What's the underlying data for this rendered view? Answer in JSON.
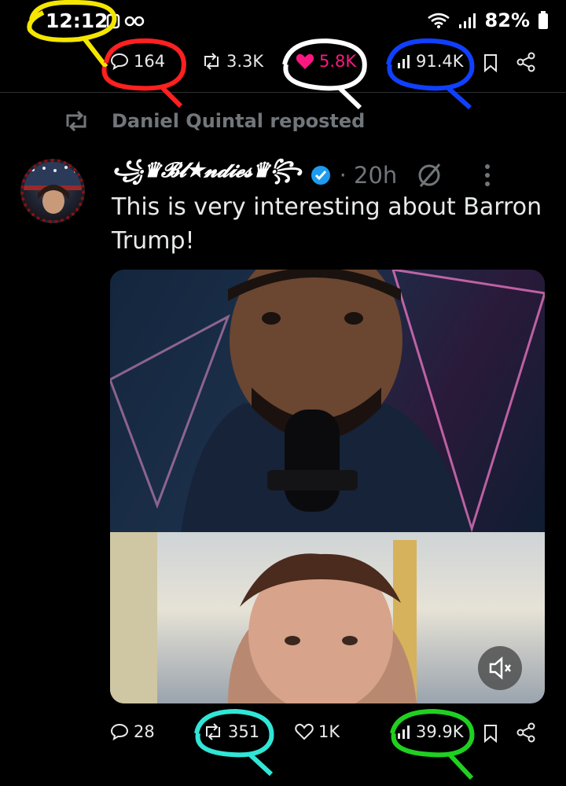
{
  "status_bar": {
    "time": "12:12",
    "battery": "82%"
  },
  "tweet1_actions": {
    "replies": "164",
    "reposts": "3.3K",
    "likes": "5.8K",
    "views": "91.4K"
  },
  "repost": {
    "text": "Daniel Quintal reposted"
  },
  "tweet2": {
    "display_name": "꧁♛𝓑𝓵★𝓷𝓭𝓲𝓮𝓼♛꧂",
    "age": "· 20h",
    "text": "This is very interesting about Barron Trump!",
    "actions": {
      "replies": "28",
      "reposts": "351",
      "likes": "1K",
      "views": "39.9K"
    }
  },
  "colors": {
    "background": "#000000",
    "like_pink": "#f91880",
    "verified_blue": "#1d9bf0",
    "muted_text": "#71767b",
    "annot_yellow": "#f5e600",
    "annot_red": "#ff2020",
    "annot_white": "#ffffff",
    "annot_blue": "#1040ff",
    "annot_cyan": "#30e6d6",
    "annot_green": "#20d020"
  }
}
